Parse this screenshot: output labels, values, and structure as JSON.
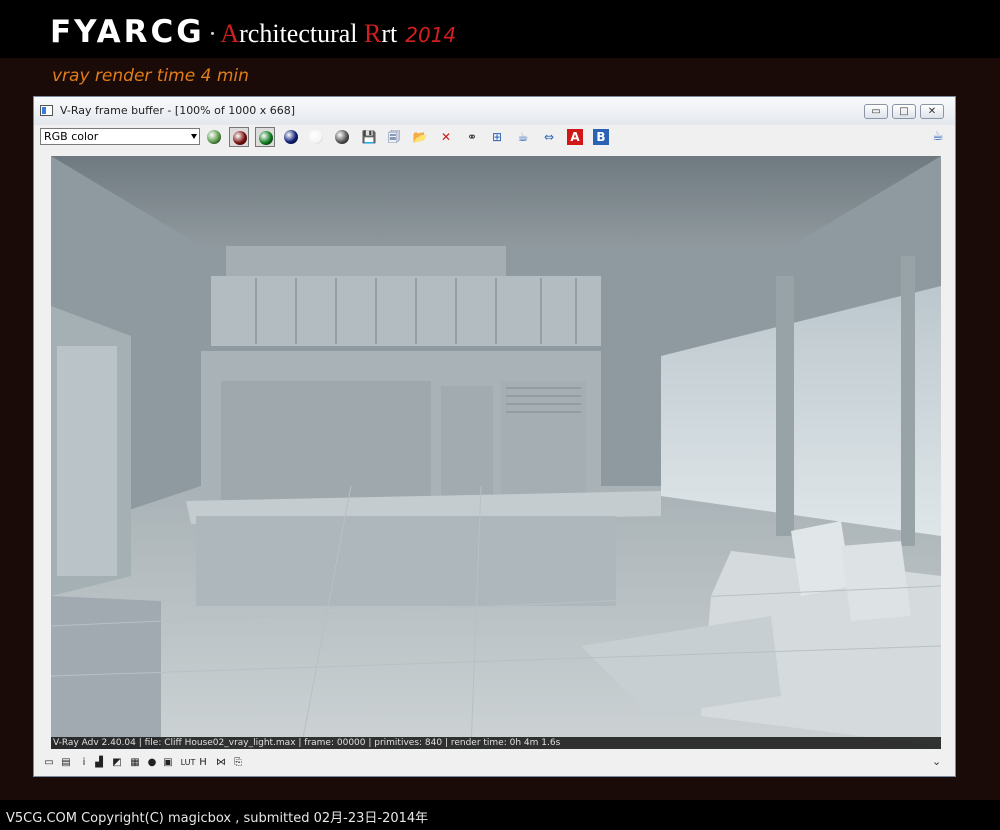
{
  "brand": {
    "logo_mark": "FYARCG",
    "dot": "·",
    "title_A": "A",
    "title_mid": "rchitectural ",
    "title_R": "R",
    "title_end": "rt",
    "year": "2014",
    "caption": "vray render  time 4 min"
  },
  "window": {
    "title": "V-Ray frame buffer - [100% of 1000 x 668]",
    "minimize_glyph": "▭",
    "maximize_glyph": "□",
    "close_glyph": "✕"
  },
  "toolbar": {
    "channel_select": "RGB color",
    "buttons": [
      {
        "name": "rgb-channels-icon",
        "color": "#5a9a4a",
        "pressed": false
      },
      {
        "name": "red-channel-icon",
        "color": "#7a0f0f",
        "pressed": true
      },
      {
        "name": "green-channel-icon",
        "color": "#0f7a1f",
        "pressed": true
      },
      {
        "name": "blue-channel-icon",
        "color": "#0f1f7a",
        "pressed": false
      },
      {
        "name": "alpha-white-icon",
        "color": "#ffffff",
        "pressed": false
      },
      {
        "name": "mono-dark-icon",
        "color": "#555555",
        "pressed": false
      }
    ],
    "tool_icons": [
      {
        "name": "save-icon",
        "glyph": "💾"
      },
      {
        "name": "save-all-icon",
        "glyph": "🗐"
      },
      {
        "name": "open-folder-icon",
        "glyph": "📂"
      },
      {
        "name": "clear-icon",
        "glyph": "✕"
      },
      {
        "name": "track-mouse-icon",
        "glyph": "⚭"
      },
      {
        "name": "region-render-icon",
        "glyph": "⊞"
      },
      {
        "name": "render-teapot-icon",
        "glyph": "☕"
      },
      {
        "name": "lut-icon",
        "glyph": "⇔"
      },
      {
        "name": "ab-compare-a-icon",
        "glyph": "A"
      },
      {
        "name": "ab-compare-b-icon",
        "glyph": "B"
      }
    ],
    "teapot_glyph": "☕"
  },
  "status_line": "V-Ray Adv 2.40.04 | file: Cliff House02_vray_light.max | frame: 00000 | primitives: 840 | render time:  0h  4m  1.6s",
  "bottom_toolbar": [
    {
      "name": "display-correction-icon",
      "glyph": "▭"
    },
    {
      "name": "film-icon",
      "glyph": "▤"
    },
    {
      "name": "info-icon",
      "glyph": "i"
    },
    {
      "name": "levels-icon",
      "glyph": "▟"
    },
    {
      "name": "color-balance-icon",
      "glyph": "◩"
    },
    {
      "name": "history-icon",
      "glyph": "▦"
    },
    {
      "name": "pixel-aspect-icon",
      "glyph": "●"
    },
    {
      "name": "lens-effects-icon",
      "glyph": "▣"
    },
    {
      "name": "lut-label-icon",
      "glyph": "LUT"
    },
    {
      "name": "histogram-icon",
      "glyph": "H"
    },
    {
      "name": "compare-icon",
      "glyph": "⋈"
    },
    {
      "name": "stamp-icon",
      "glyph": "⎘"
    }
  ],
  "collapse_glyph": "⌄",
  "footer": "V5CG.COM   Copyright(C)  magicbox ,   submitted 02月-23日-2014年"
}
